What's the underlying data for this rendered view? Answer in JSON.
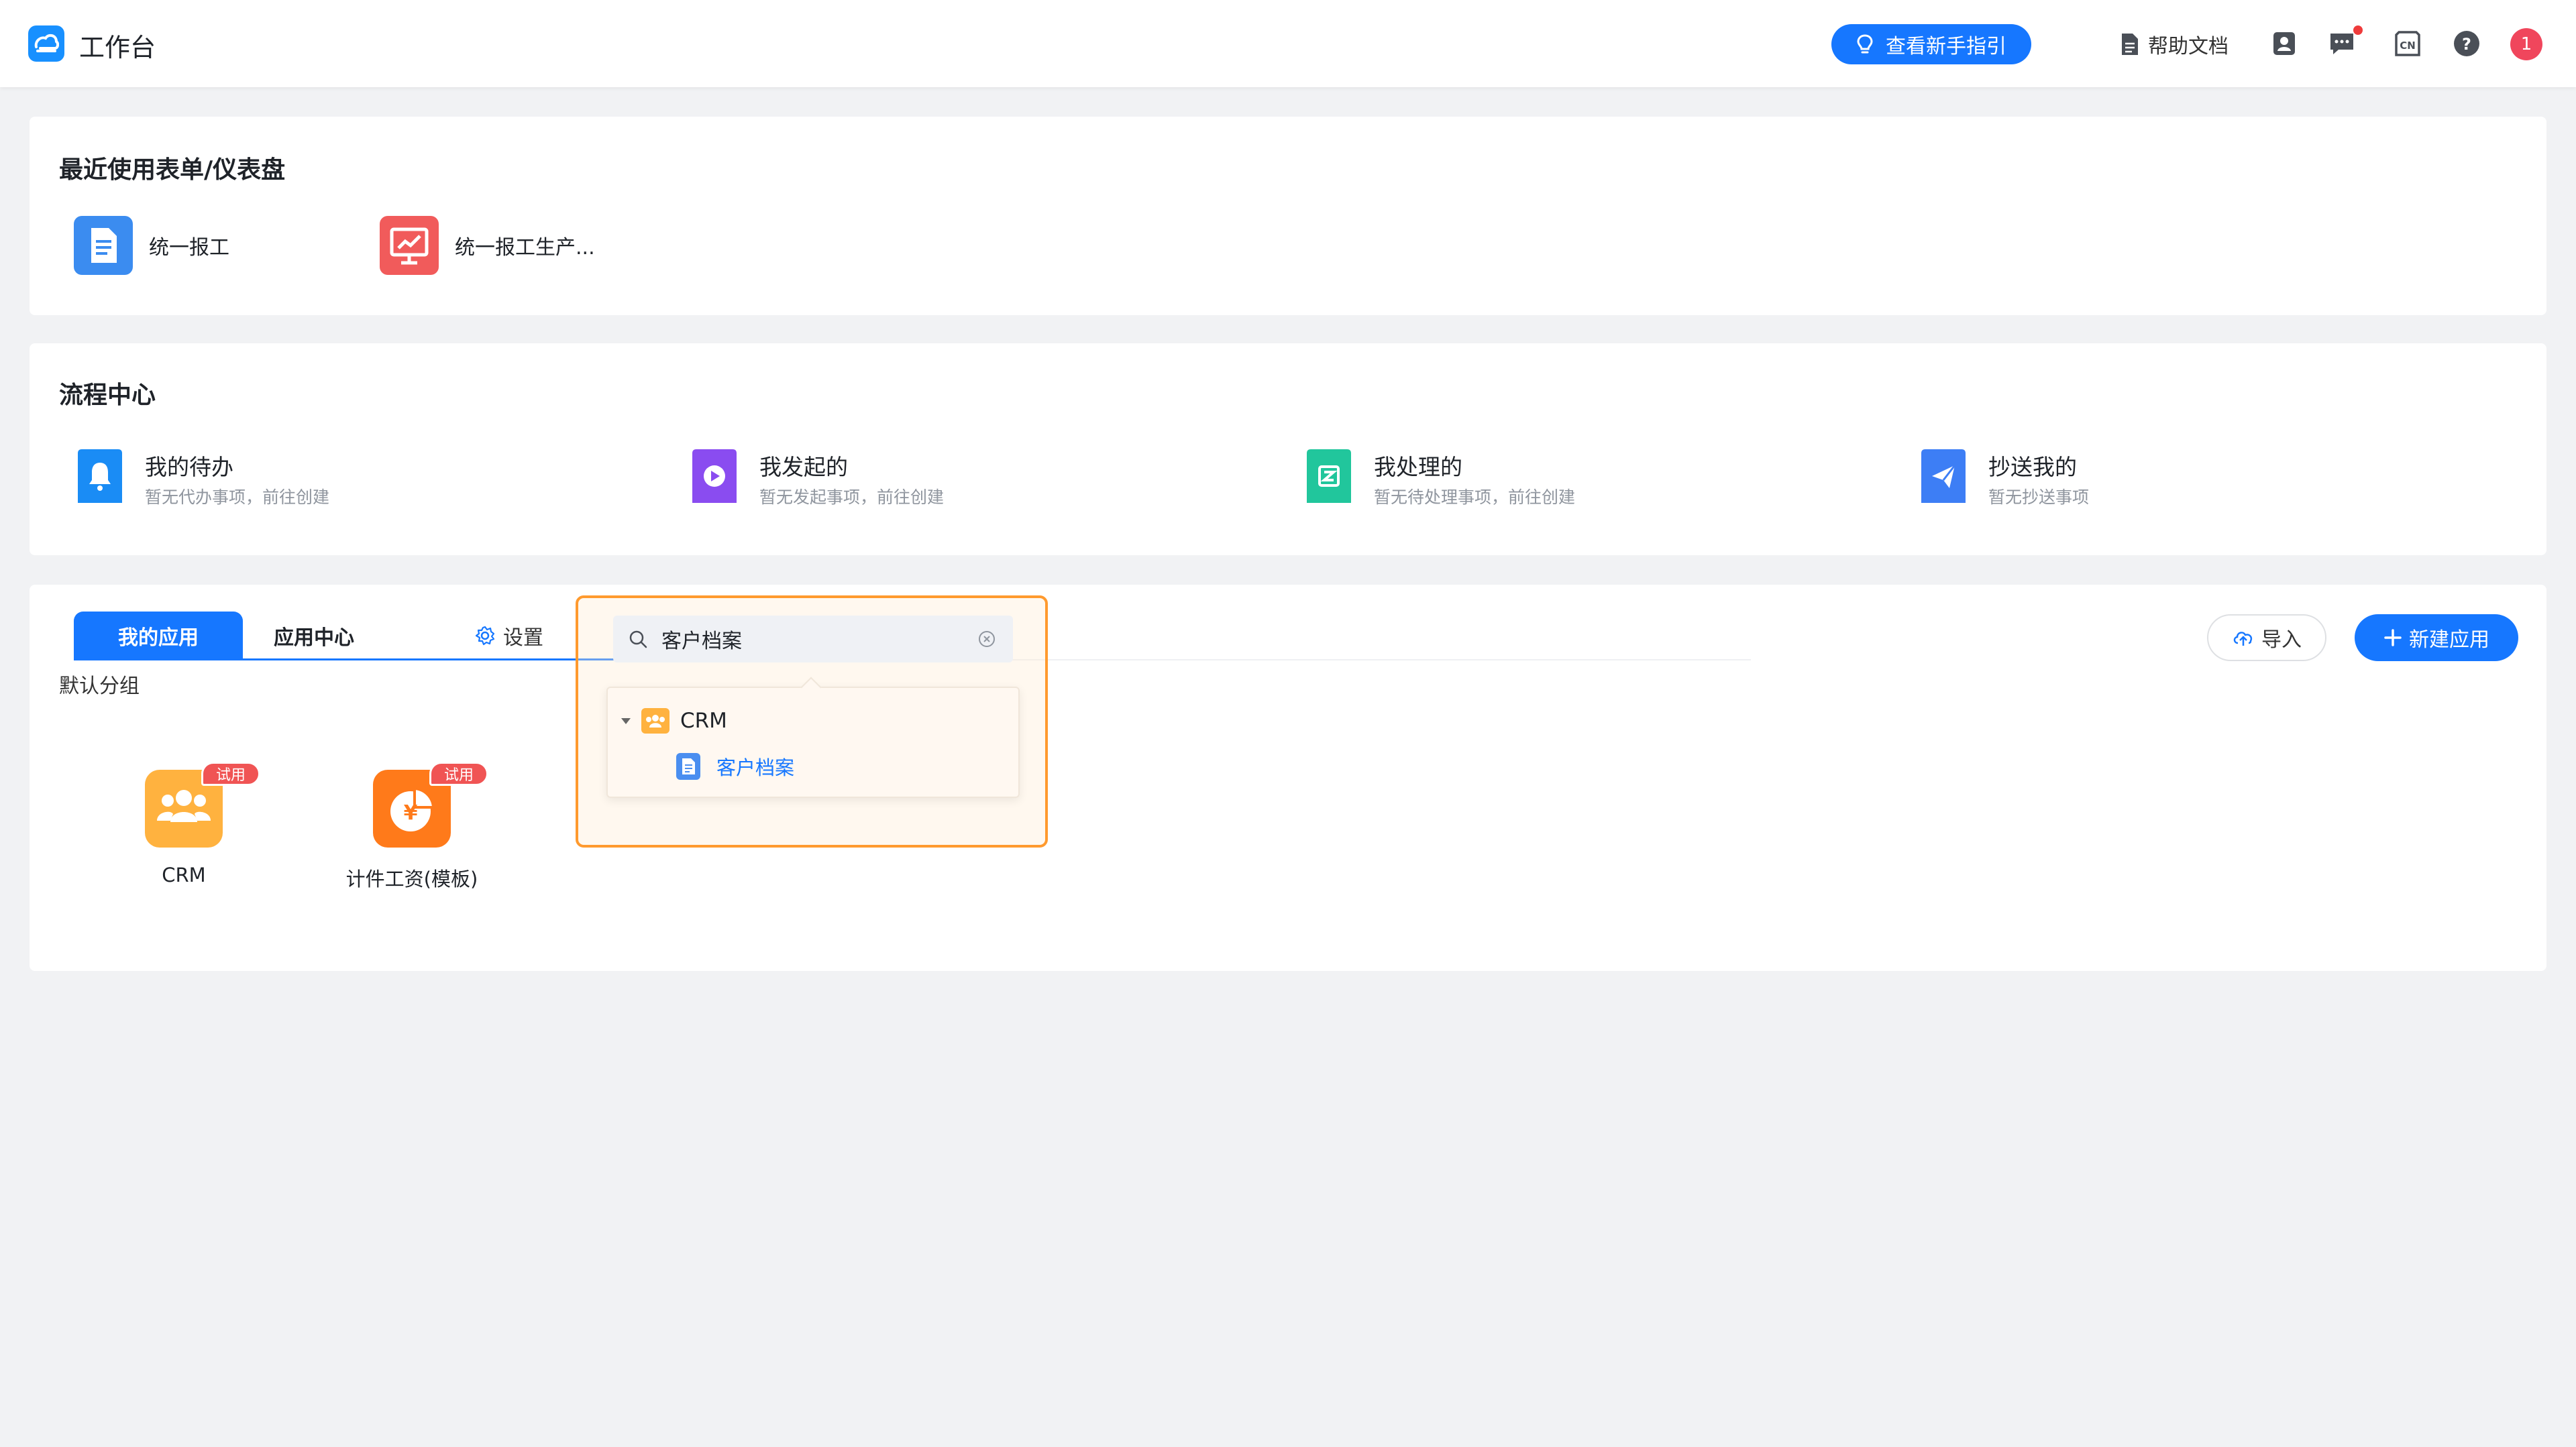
{
  "header": {
    "app_title": "工作台",
    "guide_button": "查看新手指引",
    "help_docs": "帮助文档",
    "language_icon_text": "CN",
    "avatar_text": "1"
  },
  "recent": {
    "title": "最近使用表单/仪表盘",
    "items": [
      {
        "label": "统一报工",
        "icon": "form-icon",
        "color": "#3b8cf0"
      },
      {
        "label": "统一报工生产...",
        "icon": "dashboard-icon",
        "color": "#f15b5b"
      }
    ]
  },
  "flow": {
    "title": "流程中心",
    "items": [
      {
        "title": "我的待办",
        "subtitle": "暂无代办事项，前往创建",
        "icon": "bell-icon",
        "color": "#1a8cf5"
      },
      {
        "title": "我发起的",
        "subtitle": "暂无发起事项，前往创建",
        "icon": "play-icon",
        "color": "#8a4cf0"
      },
      {
        "title": "我处理的",
        "subtitle": "暂无待处理事项，前往创建",
        "icon": "check-doc-icon",
        "color": "#21c69c"
      },
      {
        "title": "抄送我的",
        "subtitle": "暂无抄送事项",
        "icon": "send-icon",
        "color": "#3d7ef5"
      }
    ]
  },
  "apps": {
    "tabs": [
      {
        "label": "我的应用",
        "active": true
      },
      {
        "label": "应用中心",
        "active": false
      }
    ],
    "settings_label": "设置",
    "group_label": "默认分组",
    "import_label": "导入",
    "new_app_label": "新建应用",
    "items": [
      {
        "name": "CRM",
        "badge": "试用",
        "icon": "people-icon",
        "color": "#ffb23f"
      },
      {
        "name": "计件工资(模板)",
        "badge": "试用",
        "icon": "yuan-chart-icon",
        "color": "#ff7a1a"
      }
    ]
  },
  "search": {
    "value": "客户档案",
    "results": {
      "group": "CRM",
      "items": [
        "客户档案"
      ]
    }
  },
  "colors": {
    "primary": "#1677ff",
    "highlight": "#ff9a2e",
    "badge_red": "#f05454"
  }
}
